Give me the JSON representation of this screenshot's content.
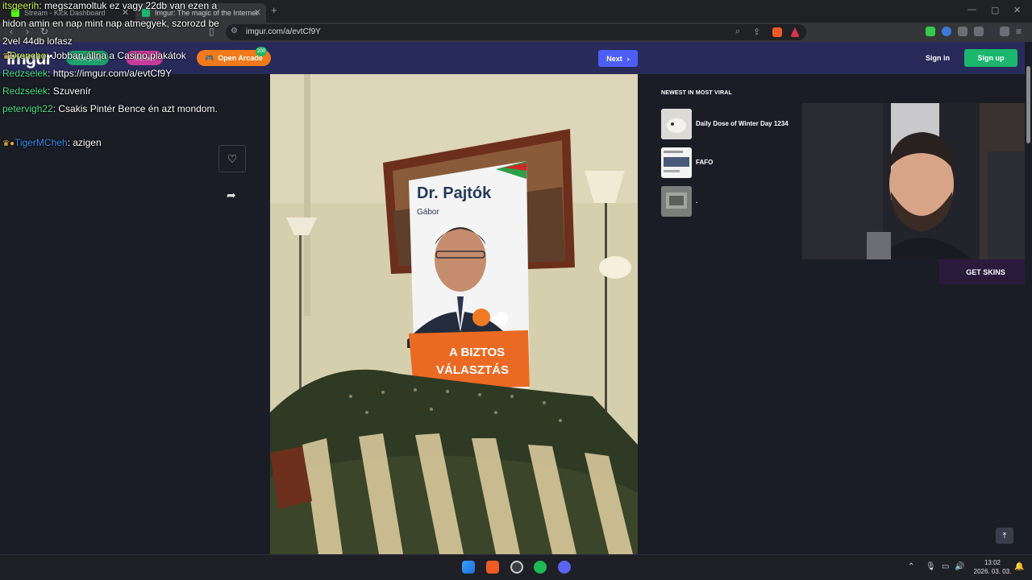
{
  "browser": {
    "tabs": [
      {
        "label": "Stream - Kick Dashboard"
      },
      {
        "label": "Imgur: The magic of the Internet"
      }
    ],
    "url": "imgur.com/a/evtCf9Y"
  },
  "imgur": {
    "logo": "imgur",
    "pill_new_post": "New post",
    "pill_memes": "Memes",
    "open_arcade": "Open Arcade",
    "arcade_badge": "200",
    "next_label": "Next",
    "sign_in": "Sign in",
    "sign_up": "Sign up",
    "viral_title": "NEWEST IN MOST VIRAL",
    "viral_items": [
      {
        "title": "Daily Dose of Winter Day 1234"
      },
      {
        "title": "FAFO"
      },
      {
        "title": "."
      }
    ]
  },
  "poster": {
    "name": "Dr. Pajtók",
    "first_name": "Gábor",
    "slogan_1": "A BIZTOS",
    "slogan_2": "VÁLASZTÁS"
  },
  "chat": [
    {
      "user": "itsgeerih",
      "text": ": megszamoltuk ez vagy 22db van ezen a hidon amin en nap mint nap atmegyek, szorozd be 2vel 44db lofasz",
      "color": "#c9f24a"
    },
    {
      "user": "Drencho",
      "text": ": Jobban állna a Casino plakátok",
      "color": "#c9f24a"
    },
    {
      "user": "Redzselek",
      "text": ": https://imgur.com/a/evtCf9Y",
      "color": "#4fe08a"
    },
    {
      "user": "Redzselek",
      "text": ": Szuvenír",
      "color": "#4fe08a"
    },
    {
      "user": "petervigh22",
      "text": ": Csakis Pintér Bence én azt mondom.",
      "color": "#4fe08a"
    },
    {
      "user": "TigerMCheh",
      "text": ": azigen",
      "color": "#3b8df0"
    }
  ],
  "stream": {
    "get_skins": "GET SKINS"
  },
  "taskbar": {
    "time": "13:02",
    "date": "2026. 03. 03."
  }
}
